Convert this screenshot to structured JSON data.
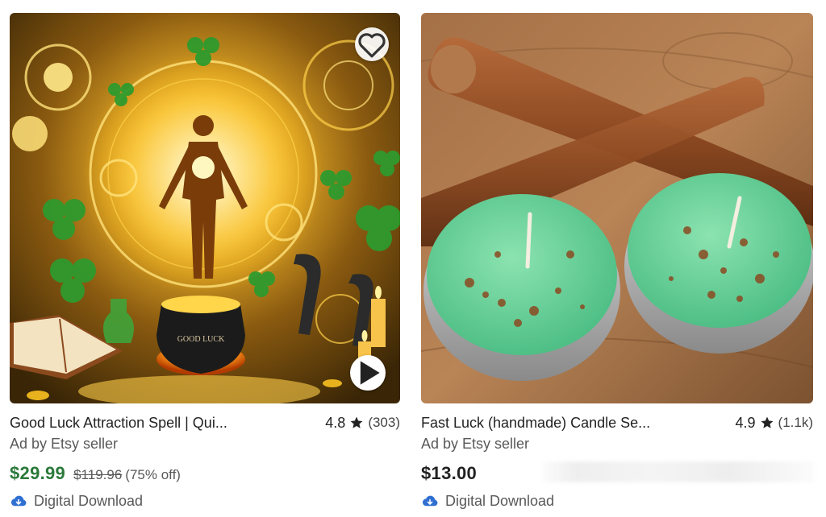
{
  "listings": [
    {
      "title": "Good Luck Attraction Spell | Qui...",
      "rating": "4.8",
      "review_count": "(303)",
      "ad_label": "Ad by Etsy seller",
      "price": "$29.99",
      "original_price": "$119.96",
      "discount": "(75% off)",
      "delivery": "Digital Download",
      "image_text": "GOOD LUCK",
      "icons": [
        "heart-icon",
        "play-icon",
        "star-icon",
        "cloud-download-icon"
      ]
    },
    {
      "title": "Fast Luck (handmade) Candle Se...",
      "rating": "4.9",
      "review_count": "(1.1k)",
      "ad_label": "Ad by Etsy seller",
      "price": "$13.00",
      "delivery": "Digital Download",
      "icons": [
        "star-icon",
        "cloud-download-icon"
      ]
    }
  ],
  "colors": {
    "sale_price": "#2b7a3a",
    "text": "#222222",
    "muted": "#595959",
    "cloud_icon": "#2f6fd1"
  }
}
